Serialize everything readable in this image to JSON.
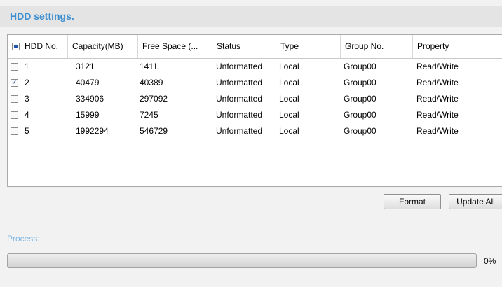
{
  "header": {
    "title": "HDD settings."
  },
  "table": {
    "columns": [
      "HDD No.",
      "Capacity(MB)",
      "Free Space (...",
      "Status",
      "Type",
      "Group No.",
      "Property"
    ],
    "rows": [
      {
        "checked": false,
        "no": "1",
        "capacity": "3121",
        "free": "1411",
        "status": "Unformatted",
        "type": "Local",
        "group": "Group00",
        "property": "Read/Write"
      },
      {
        "checked": true,
        "no": "2",
        "capacity": "40479",
        "free": "40389",
        "status": "Unformatted",
        "type": "Local",
        "group": "Group00",
        "property": "Read/Write"
      },
      {
        "checked": false,
        "no": "3",
        "capacity": "334906",
        "free": "297092",
        "status": "Unformatted",
        "type": "Local",
        "group": "Group00",
        "property": "Read/Write"
      },
      {
        "checked": false,
        "no": "4",
        "capacity": "15999",
        "free": "7245",
        "status": "Unformatted",
        "type": "Local",
        "group": "Group00",
        "property": "Read/Write"
      },
      {
        "checked": false,
        "no": "5",
        "capacity": "1992294",
        "free": "546729",
        "status": "Unformatted",
        "type": "Local",
        "group": "Group00",
        "property": "Read/Write"
      }
    ]
  },
  "buttons": {
    "format": "Format",
    "update_all": "Update All"
  },
  "process": {
    "label": "Process:",
    "percent_text": "0%",
    "progress": 0
  },
  "colors": {
    "title": "#3d8fd1",
    "process_label": "#7fb7e1"
  }
}
